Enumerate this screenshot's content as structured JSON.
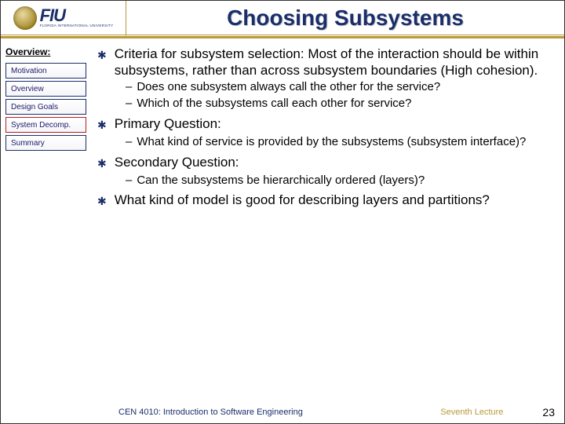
{
  "header": {
    "logo_acronym": "FIU",
    "logo_subtext": "FLORIDA INTERNATIONAL UNIVERSITY",
    "title": "Choosing Subsystems"
  },
  "sidebar": {
    "heading": "Overview:",
    "items": [
      {
        "label": "Motivation",
        "active": false
      },
      {
        "label": "Overview",
        "active": false
      },
      {
        "label": "Design Goals",
        "active": false
      },
      {
        "label": "System Decomp.",
        "active": true
      },
      {
        "label": "Summary",
        "active": false
      }
    ]
  },
  "content": {
    "points": [
      {
        "text": "Criteria for subsystem selection: Most of the interaction should be within subsystems, rather than across subsystem boundaries (High cohesion).",
        "subs": [
          "Does one subsystem always call the other for the service?",
          "Which of the subsystems call each other for service?"
        ]
      },
      {
        "text": "Primary Question:",
        "subs": [
          "What kind of service is provided by the subsystems (subsystem interface)?"
        ]
      },
      {
        "text": "Secondary Question:",
        "subs": [
          " Can the subsystems be hierarchically ordered (layers)?"
        ]
      },
      {
        "text": "What kind of model is good for describing layers and partitions?",
        "subs": []
      }
    ]
  },
  "footer": {
    "course": "CEN 4010: Introduction to Software Engineering",
    "lecture": "Seventh Lecture",
    "page": "23"
  }
}
